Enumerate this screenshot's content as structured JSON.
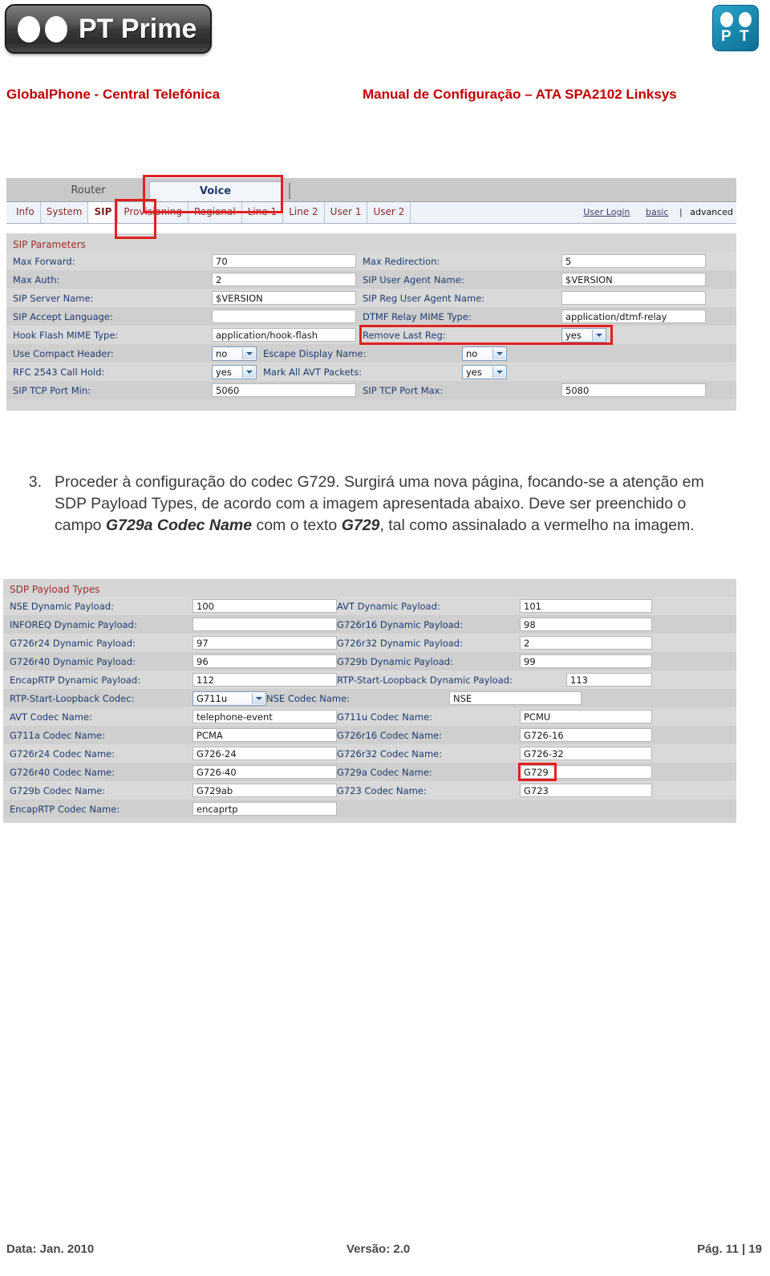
{
  "header": {
    "brand_logo_text": "PT Prime",
    "brand_mark_letters": [
      "P",
      "T"
    ],
    "left_title": "GlobalPhone - Central Telefónica",
    "right_title": "Manual de Configuração – ATA SPA2102 Linksys",
    "accent_color": "#c00000"
  },
  "sip_screenshot": {
    "top_tabs": [
      {
        "label": "Router",
        "active": false,
        "highlighted": false
      },
      {
        "label": "Voice",
        "active": true,
        "highlighted": true
      }
    ],
    "sub_tabs": [
      {
        "label": "Info",
        "active": false
      },
      {
        "label": "System",
        "active": false
      },
      {
        "label": "SIP",
        "active": true,
        "highlighted": true
      },
      {
        "label": "Provisioning",
        "active": false
      },
      {
        "label": "Regional",
        "active": false
      },
      {
        "label": "Line 1",
        "active": false
      },
      {
        "label": "Line 2",
        "active": false
      },
      {
        "label": "User 1",
        "active": false
      },
      {
        "label": "User 2",
        "active": false
      }
    ],
    "links": {
      "user_login": "User Login",
      "basic": "basic",
      "separator": "|",
      "advanced": "advanced"
    },
    "section_title": "SIP Parameters",
    "rows": [
      {
        "left_label": "Max Forward:",
        "left_value": "70",
        "left_type": "text",
        "right_label": "Max Redirection:",
        "right_value": "5",
        "right_type": "text"
      },
      {
        "left_label": "Max Auth:",
        "left_value": "2",
        "left_type": "text",
        "right_label": "SIP User Agent Name:",
        "right_value": "$VERSION",
        "right_type": "text"
      },
      {
        "left_label": "SIP Server Name:",
        "left_value": "$VERSION",
        "left_type": "text",
        "right_label": "SIP Reg User Agent Name:",
        "right_value": "",
        "right_type": "text"
      },
      {
        "left_label": "SIP Accept Language:",
        "left_value": "",
        "left_type": "text",
        "right_label": "DTMF Relay MIME Type:",
        "right_value": "application/dtmf-relay",
        "right_type": "text"
      },
      {
        "left_label": "Hook Flash MIME Type:",
        "left_value": "application/hook-flash",
        "left_type": "text",
        "right_label": "Remove Last Reg:",
        "right_value": "yes",
        "right_type": "select",
        "right_highlighted": true
      },
      {
        "left_label": "Use Compact Header:",
        "left_value": "no",
        "left_type": "select",
        "right_label": "Escape Display Name:",
        "right_value": "no",
        "right_type": "select"
      },
      {
        "left_label": "RFC 2543 Call Hold:",
        "left_value": "yes",
        "left_type": "select",
        "right_label": "Mark All AVT Packets:",
        "right_value": "yes",
        "right_type": "select"
      },
      {
        "left_label": "SIP TCP Port Min:",
        "left_value": "5060",
        "left_type": "text",
        "right_label": "SIP TCP Port Max:",
        "right_value": "5080",
        "right_type": "text"
      }
    ]
  },
  "instruction": {
    "number": "3.",
    "part1": "Proceder à configuração do codec G729. Surgirá uma nova página, focando-se a atenção em SDP Payload Types, de acordo com a imagem apresentada abaixo. Deve ser preenchido o campo ",
    "bold1": "G729a Codec Name",
    "part2": " com o texto ",
    "bold2": "G729",
    "part3": ", tal como assinalado a vermelho na imagem."
  },
  "sdp_screenshot": {
    "section_title": "SDP Payload Types",
    "rows": [
      {
        "left_label": "NSE Dynamic Payload:",
        "left_value": "100",
        "left_type": "text",
        "right_label": "AVT Dynamic Payload:",
        "right_value": "101",
        "right_type": "text"
      },
      {
        "left_label": "INFOREQ Dynamic Payload:",
        "left_value": "",
        "left_type": "text",
        "right_label": "G726r16 Dynamic Payload:",
        "right_value": "98",
        "right_type": "text"
      },
      {
        "left_label": "G726r24 Dynamic Payload:",
        "left_value": "97",
        "left_type": "text",
        "right_label": "G726r32 Dynamic Payload:",
        "right_value": "2",
        "right_type": "text"
      },
      {
        "left_label": "G726r40 Dynamic Payload:",
        "left_value": "96",
        "left_type": "text",
        "right_label": "G729b Dynamic Payload:",
        "right_value": "99",
        "right_type": "text"
      },
      {
        "left_label": "EncapRTP Dynamic Payload:",
        "left_value": "112",
        "left_type": "text",
        "right_label": "RTP-Start-Loopback Dynamic Payload:",
        "right_value": "113",
        "right_type": "text",
        "right_wide_label": true
      },
      {
        "left_label": "RTP-Start-Loopback Codec:",
        "left_value": "G711u",
        "left_type": "select",
        "right_label": "NSE Codec Name:",
        "right_value": "NSE",
        "right_type": "text"
      },
      {
        "left_label": "AVT Codec Name:",
        "left_value": "telephone-event",
        "left_type": "text",
        "right_label": "G711u Codec Name:",
        "right_value": "PCMU",
        "right_type": "text"
      },
      {
        "left_label": "G711a Codec Name:",
        "left_value": "PCMA",
        "left_type": "text",
        "right_label": "G726r16 Codec Name:",
        "right_value": "G726-16",
        "right_type": "text"
      },
      {
        "left_label": "G726r24 Codec Name:",
        "left_value": "G726-24",
        "left_type": "text",
        "right_label": "G726r32 Codec Name:",
        "right_value": "G726-32",
        "right_type": "text"
      },
      {
        "left_label": "G726r40 Codec Name:",
        "left_value": "G726-40",
        "left_type": "text",
        "right_label": "G729a Codec Name:",
        "right_value": "G729",
        "right_type": "text",
        "right_highlighted": true
      },
      {
        "left_label": "G729b Codec Name:",
        "left_value": "G729ab",
        "left_type": "text",
        "right_label": "G723 Codec Name:",
        "right_value": "G723",
        "right_type": "text"
      },
      {
        "left_label": "EncapRTP Codec Name:",
        "left_value": "encaprtp",
        "left_type": "text",
        "right_label": "",
        "right_value": "",
        "right_type": "none"
      }
    ]
  },
  "footer": {
    "date": "Data: Jan. 2010",
    "version": "Versão: 2.0",
    "page": "Pág. 11 | 19"
  }
}
